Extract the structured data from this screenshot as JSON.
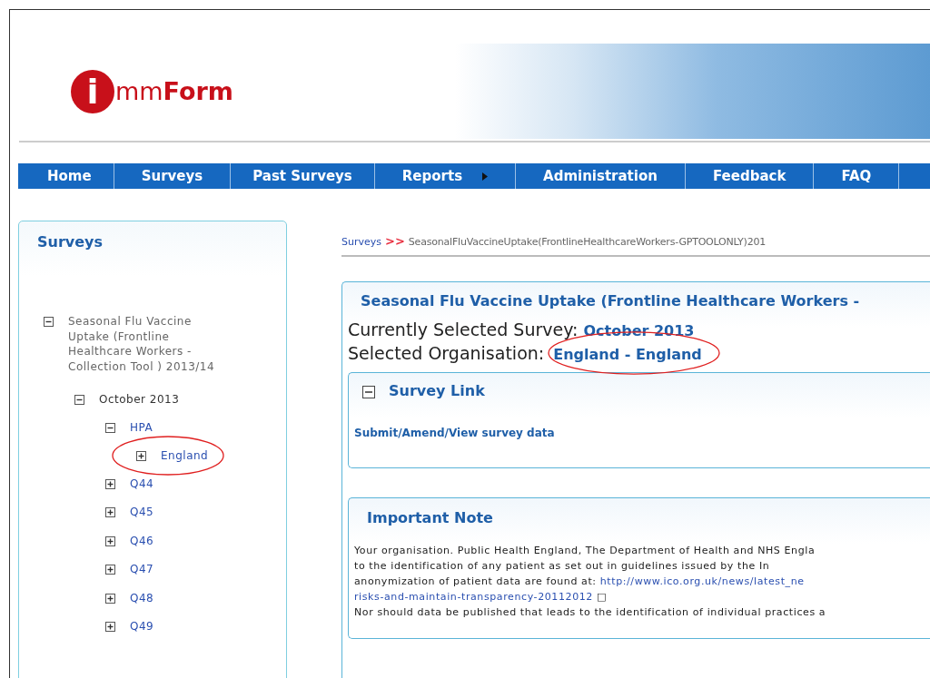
{
  "logo": {
    "letter": "i",
    "text_light": "mm",
    "text_bold": "Form"
  },
  "nav": [
    {
      "label": "Home",
      "has_submenu": false
    },
    {
      "label": "Surveys",
      "has_submenu": false
    },
    {
      "label": "Past Surveys",
      "has_submenu": false
    },
    {
      "label": "Reports",
      "has_submenu": true
    },
    {
      "label": "Administration",
      "has_submenu": false
    },
    {
      "label": "Feedback",
      "has_submenu": false
    },
    {
      "label": "FAQ",
      "has_submenu": false
    }
  ],
  "sidebar": {
    "title": "Surveys",
    "tree": [
      {
        "label": "Seasonal Flu Vaccine Uptake (Frontline Healthcare Workers -Collection Tool ) 2013/14",
        "expanded": true,
        "highlighted": false,
        "children": [
          {
            "label": "October 2013",
            "expanded": true,
            "highlighted": false,
            "children": [
              {
                "label": "HPA",
                "expanded": true,
                "highlighted": false,
                "children": [
                  {
                    "label": "England",
                    "expanded": false,
                    "highlighted": true
                  }
                ]
              },
              {
                "label": "Q44",
                "expanded": false,
                "highlighted": false
              },
              {
                "label": "Q45",
                "expanded": false,
                "highlighted": false
              },
              {
                "label": "Q46",
                "expanded": false,
                "highlighted": false
              },
              {
                "label": "Q47",
                "expanded": false,
                "highlighted": false
              },
              {
                "label": "Q48",
                "expanded": false,
                "highlighted": false
              },
              {
                "label": "Q49",
                "expanded": false,
                "highlighted": false
              }
            ]
          }
        ]
      }
    ]
  },
  "breadcrumb": {
    "link": "Surveys",
    "separator": ">>",
    "current": "SeasonalFluVaccineUptake(FrontlineHealthcareWorkers-GPTOOLONLY)201"
  },
  "main": {
    "title": "Seasonal Flu Vaccine Uptake (Frontline Healthcare Workers -",
    "survey_label": "Currently Selected Survey:",
    "survey_value": "October 2013",
    "org_label": "Selected Organisation:",
    "org_value": "England - England",
    "org_highlighted": true
  },
  "survey_link_panel": {
    "title": "Survey Link",
    "expanded": true,
    "link": "Submit/Amend/View survey data"
  },
  "note": {
    "title": "Important Note",
    "lines": [
      [
        {
          "text": "Your organisation. Public Health England, The Department of Health and NHS Engla",
          "link": false
        }
      ],
      [
        {
          "text": "to the identification of any patient as set out in guidelines issued by the In",
          "link": false
        }
      ],
      [
        {
          "text": "anonymization of patient data are found at: ",
          "link": false
        },
        {
          "text": "http://www.ico.org.uk/news/latest_ne",
          "link": true
        }
      ],
      [
        {
          "text": "risks-and-maintain-transparency-20112012",
          "link": true
        },
        {
          "text": " □",
          "link": false
        }
      ],
      [
        {
          "text": "Nor should data be published that leads to the identification of individual practices a",
          "link": false
        }
      ]
    ]
  }
}
